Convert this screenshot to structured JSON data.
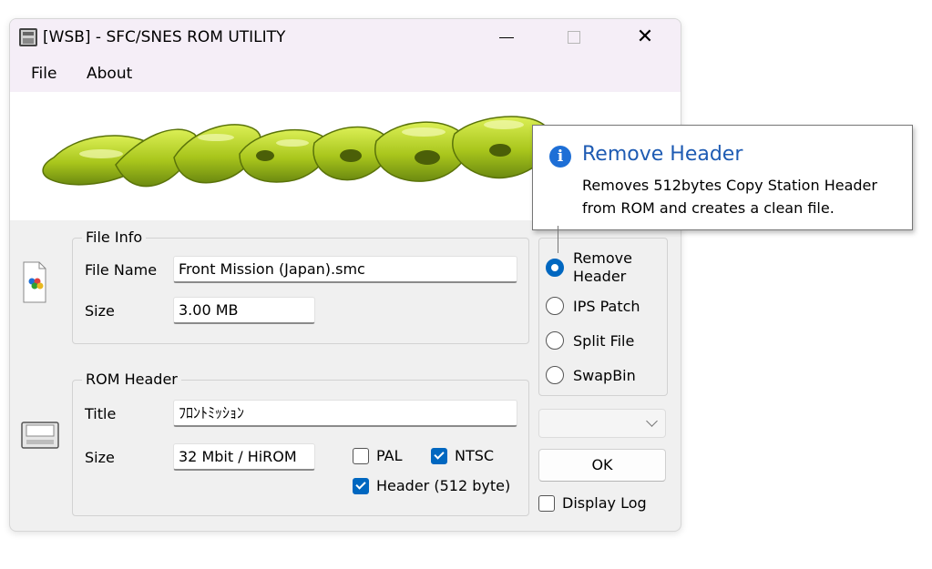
{
  "window": {
    "title": "[WSB] - SFC/SNES ROM UTILITY",
    "icon": "floppy-app-icon",
    "close_glyph": "✕"
  },
  "menu": {
    "file": "File",
    "about": "About"
  },
  "banner": {
    "logo": "Wason",
    "logo_color": "#b5d021"
  },
  "file_info": {
    "legend": "File Info",
    "icon": "rom-file-icon",
    "file_name_label": "File Name",
    "file_name_value": "Front Mission (Japan).smc",
    "size_label": "Size",
    "size_value": "3.00 MB"
  },
  "rom_header": {
    "legend": "ROM Header",
    "icon": "cartridge-icon",
    "title_label": "Title",
    "title_value": "ﾌﾛﾝﾄﾐｯｼｮﾝ",
    "size_label": "Size",
    "size_value": "32 Mbit / HiROM",
    "pal_label": "PAL",
    "pal_checked": false,
    "ntsc_label": "NTSC",
    "ntsc_checked": true,
    "header_label": "Header (512 byte)",
    "header_checked": true
  },
  "actions": {
    "options": [
      {
        "label": "Remove Header",
        "selected": true
      },
      {
        "label": "IPS Patch",
        "selected": false
      },
      {
        "label": "Split File",
        "selected": false
      },
      {
        "label": "SwapBin",
        "selected": false
      }
    ],
    "dropdown_value": "",
    "ok_label": "OK",
    "display_log_label": "Display Log",
    "display_log_checked": false
  },
  "tooltip": {
    "icon": "info-icon",
    "title": "Remove Header",
    "text": "Removes 512bytes Copy Station Header from ROM and creates a clean file."
  },
  "colors": {
    "accent": "#0067c0",
    "title_bar": "#f5eef7",
    "tooltip_title": "#1e5bb3"
  }
}
